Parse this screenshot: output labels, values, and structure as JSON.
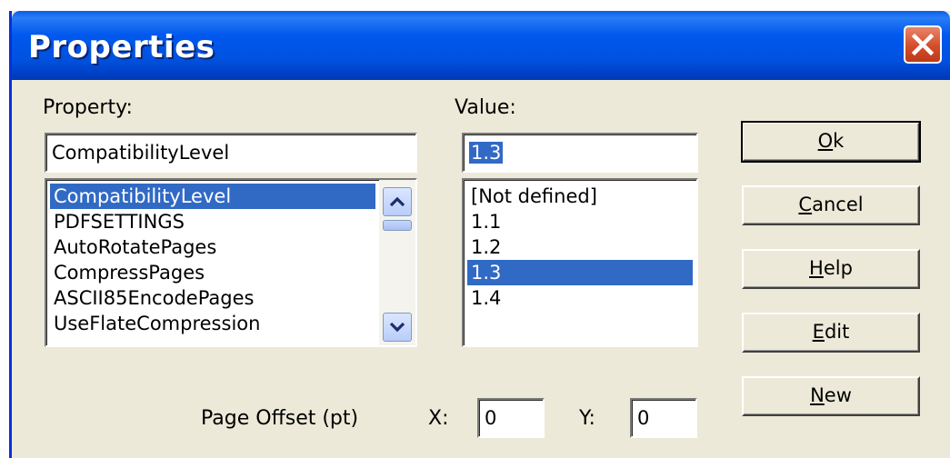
{
  "dialog": {
    "title": "Properties",
    "close_label": "×"
  },
  "property": {
    "label": "Property:",
    "current_value": "CompatibilityLevel",
    "items": [
      {
        "label": "CompatibilityLevel",
        "selected": true
      },
      {
        "label": "PDFSETTINGS",
        "selected": false
      },
      {
        "label": "AutoRotatePages",
        "selected": false
      },
      {
        "label": "CompressPages",
        "selected": false
      },
      {
        "label": "ASCII85EncodePages",
        "selected": false
      },
      {
        "label": "UseFlateCompression",
        "selected": false
      }
    ]
  },
  "value": {
    "label": "Value:",
    "current_value": "1.3",
    "items": [
      {
        "label": "[Not defined]",
        "selected": false
      },
      {
        "label": "1.1",
        "selected": false
      },
      {
        "label": "1.2",
        "selected": false
      },
      {
        "label": "1.3",
        "selected": true
      },
      {
        "label": "1.4",
        "selected": false
      }
    ]
  },
  "buttons": {
    "ok": {
      "key": "O",
      "rest": "k"
    },
    "cancel": {
      "key": "C",
      "rest": "ancel"
    },
    "help": {
      "key": "H",
      "rest": "elp"
    },
    "edit": {
      "key": "E",
      "rest": "dit"
    },
    "new": {
      "key": "N",
      "rest": "ew"
    }
  },
  "offset": {
    "label": "Page Offset (pt)",
    "x_label": "X:",
    "x_value": "0",
    "y_label": "Y:",
    "y_value": "0"
  },
  "colors": {
    "title_bar": "#0054e3",
    "selection": "#316ac5",
    "dialog_bg": "#ece9d8",
    "close_button": "#d34d2b"
  }
}
